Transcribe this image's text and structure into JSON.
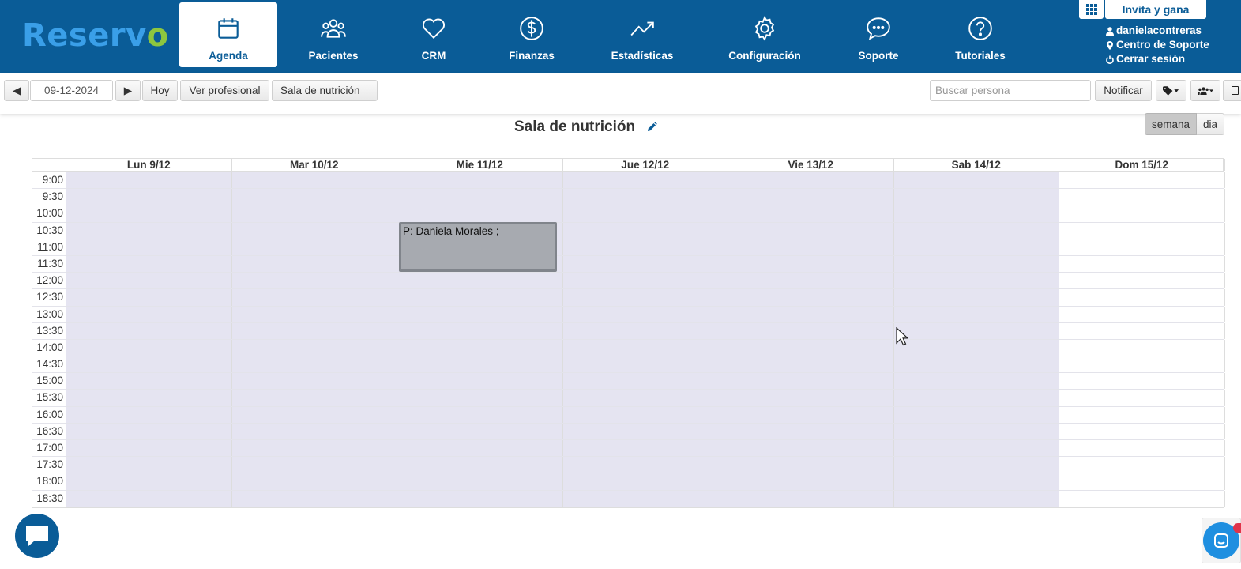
{
  "app": {
    "logo_text": "Reserv",
    "logo_check": "o",
    "brand_color": "#0a5c97"
  },
  "nav": {
    "items": [
      {
        "label": "Agenda",
        "icon": "calendar-icon",
        "active": true
      },
      {
        "label": "Pacientes",
        "icon": "users-icon"
      },
      {
        "label": "CRM",
        "icon": "heart-icon"
      },
      {
        "label": "Finanzas",
        "icon": "dollar-icon"
      },
      {
        "label": "Estadísticas",
        "icon": "trend-icon"
      },
      {
        "label": "Configuración",
        "icon": "gear-icon"
      },
      {
        "label": "Soporte",
        "icon": "chat-bubble-icon"
      },
      {
        "label": "Tutoriales",
        "icon": "help-circle-icon"
      }
    ]
  },
  "top_right": {
    "invite_label": "Invita y gana",
    "username": "danielacontreras",
    "support_center": "Centro de Soporte",
    "logout": "Cerrar sesión"
  },
  "toolbar": {
    "date_value": "09-12-2024",
    "today_label": "Hoy",
    "view_professional_label": "Ver profesional",
    "room_label": "Sala de nutrición",
    "search_placeholder": "Buscar persona",
    "notify_label": "Notificar"
  },
  "calendar": {
    "title": "Sala de nutrición",
    "view_week": "semana",
    "view_day": "dia",
    "days": [
      "Lun 9/12",
      "Mar 10/12",
      "Mie 11/12",
      "Jue 12/12",
      "Vie 13/12",
      "Sab 14/12",
      "Dom 15/12"
    ],
    "times": [
      "9:00",
      "9:30",
      "10:00",
      "10:30",
      "11:00",
      "11:30",
      "12:00",
      "12:30",
      "13:00",
      "13:30",
      "14:00",
      "14:30",
      "15:00",
      "15:30",
      "16:00",
      "16:30",
      "17:00",
      "17:30",
      "18:00",
      "18:30"
    ],
    "available_days": 6,
    "events": [
      {
        "day": "Mie 11/12",
        "start": "10:30",
        "end": "11:30",
        "label": "P: Daniela Morales ;"
      }
    ]
  }
}
